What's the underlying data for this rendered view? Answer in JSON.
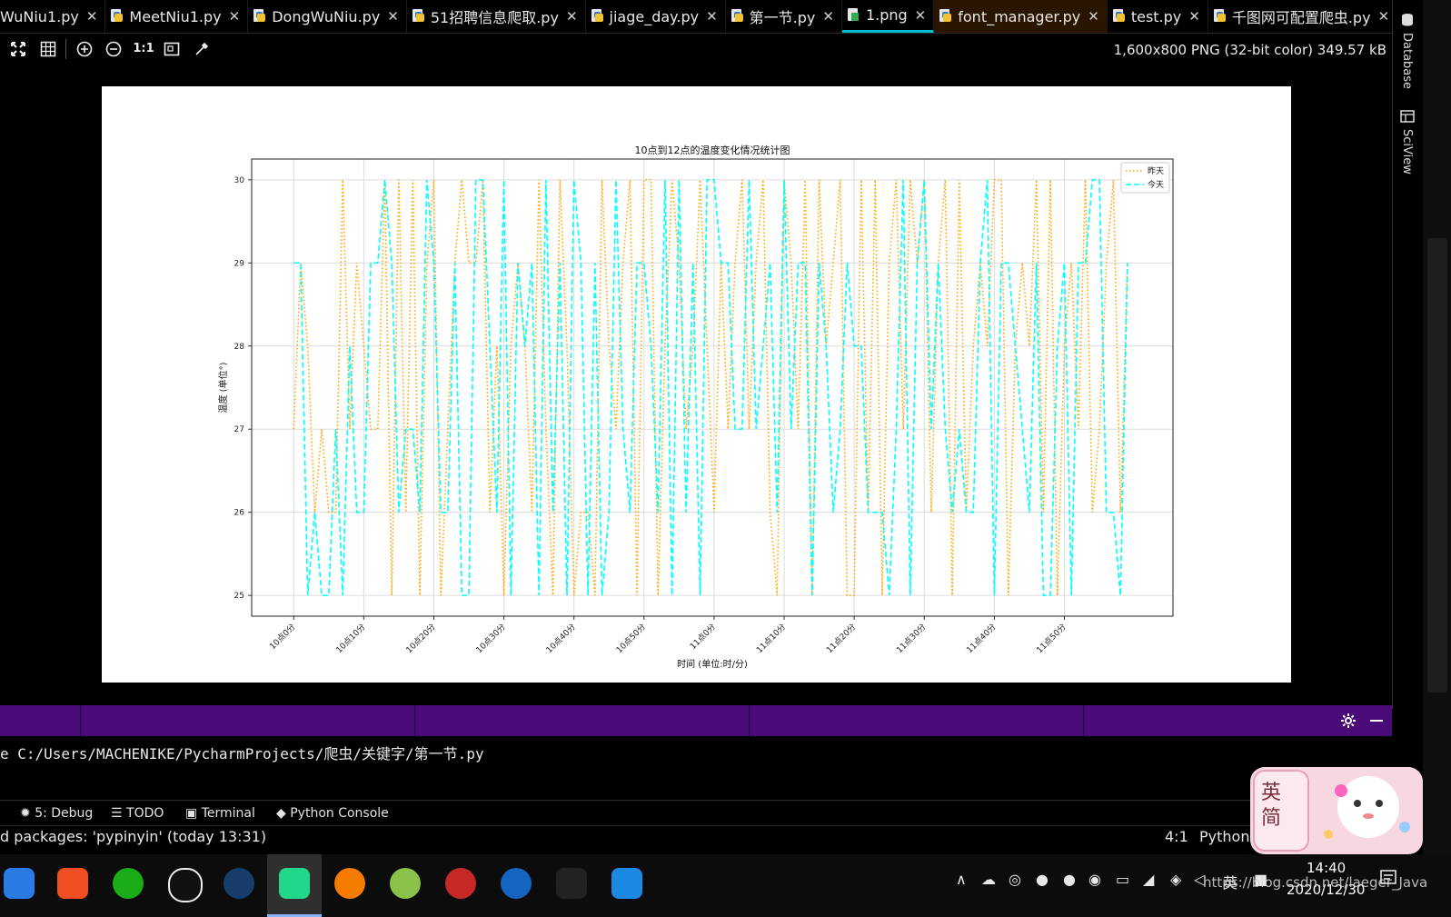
{
  "tabs": [
    {
      "label": "WuNiu1.py",
      "icon": "python-file-icon"
    },
    {
      "label": "MeetNiu1.py",
      "icon": "python-file-icon"
    },
    {
      "label": "DongWuNiu.py",
      "icon": "python-file-icon"
    },
    {
      "label": "51招聘信息爬取.py",
      "icon": "python-file-icon"
    },
    {
      "label": "jiage_day.py",
      "icon": "python-file-icon"
    },
    {
      "label": "第一节.py",
      "icon": "python-file-icon"
    },
    {
      "label": "1.png",
      "icon": "image-file-icon",
      "active": true
    },
    {
      "label": "font_manager.py",
      "icon": "python-file-icon",
      "highlighted": true
    },
    {
      "label": "test.py",
      "icon": "python-file-icon"
    },
    {
      "label": "千图网可配置爬虫.py",
      "icon": "python-file-icon"
    }
  ],
  "toolbar": {
    "zoom_actual_label": "1:1",
    "image_info": "1,600x800 PNG (32-bit color) 349.57 kB"
  },
  "right_strip": {
    "database": "Database",
    "sciview": "SciView"
  },
  "console": {
    "line": "e C:/Users/MACHENIKE/PycharmProjects/爬虫/关键字/第一节.py"
  },
  "tool_windows": {
    "debug": "5: Debug",
    "todo": "TODO",
    "terminal": "Terminal",
    "python_console": "Python Console"
  },
  "status": {
    "message": "d packages: 'pypinyin' (today 13:31)",
    "position": "4:1",
    "language": "Python"
  },
  "taskbar": {
    "time": "14:40",
    "date": "2020/12/30",
    "ime": "英",
    "watermark": "https://blog.csdn.net/laeger_Java"
  },
  "ime_sticker": {
    "line1": "英",
    "line2": "简"
  },
  "colors": {
    "accent": "#00bcd4",
    "purple": "#4a0a78",
    "yesterday": "#ffa500",
    "today": "#00ffff"
  },
  "chart_data": {
    "type": "line",
    "title": "10点到12点的温度变化情况统计图",
    "xlabel": "时间 (单位:时/分)",
    "ylabel": "温度 (单位°)",
    "ylim": [
      24.75,
      30.25
    ],
    "yticks": [
      25,
      26,
      27,
      28,
      29,
      30
    ],
    "xticks": [
      "10点0分",
      "10点10分",
      "10点20分",
      "10点30分",
      "10点40分",
      "10点50分",
      "11点0分",
      "11点10分",
      "11点20分",
      "11点30分",
      "11点40分",
      "11点50分"
    ],
    "legend": "top-right",
    "grid": true,
    "x": [
      0,
      1,
      2,
      3,
      4,
      5,
      6,
      7,
      8,
      9,
      10,
      11,
      12,
      13,
      14,
      15,
      16,
      17,
      18,
      19,
      20,
      21,
      22,
      23,
      24,
      25,
      26,
      27,
      28,
      29,
      30,
      31,
      32,
      33,
      34,
      35,
      36,
      37,
      38,
      39,
      40,
      41,
      42,
      43,
      44,
      45,
      46,
      47,
      48,
      49,
      50,
      51,
      52,
      53,
      54,
      55,
      56,
      57,
      58,
      59,
      60,
      61,
      62,
      63,
      64,
      65,
      66,
      67,
      68,
      69,
      70,
      71,
      72,
      73,
      74,
      75,
      76,
      77,
      78,
      79,
      80,
      81,
      82,
      83,
      84,
      85,
      86,
      87,
      88,
      89,
      90,
      91,
      92,
      93,
      94,
      95,
      96,
      97,
      98,
      99,
      100,
      101,
      102,
      103,
      104,
      105,
      106,
      107,
      108,
      109,
      110,
      111,
      112,
      113,
      114,
      115,
      116,
      117,
      118,
      119
    ],
    "series": [
      {
        "name": "昨天",
        "style": "dotted",
        "color": "#ffa500",
        "values": [
          27,
          29,
          28,
          26,
          27,
          26,
          26,
          30,
          27,
          29,
          28,
          27,
          27,
          30,
          25,
          30,
          26,
          30,
          25,
          29,
          30,
          25,
          27,
          29,
          30,
          29,
          29,
          30,
          26,
          28,
          25,
          28,
          29,
          28,
          26,
          30,
          27,
          25,
          30,
          28,
          25,
          26,
          26,
          25,
          30,
          28,
          27,
          29,
          30,
          25,
          30,
          30,
          25,
          28,
          30,
          29,
          27,
          28,
          30,
          28,
          26,
          29,
          27,
          29,
          30,
          27,
          29,
          30,
          26,
          25,
          30,
          29,
          27,
          30,
          25,
          30,
          28,
          29,
          30,
          25,
          25,
          30,
          26,
          30,
          25,
          29,
          30,
          27,
          30,
          29,
          30,
          26,
          29,
          30,
          25,
          30,
          26,
          28,
          29,
          28,
          30,
          30,
          25,
          28,
          29,
          28,
          30,
          26,
          30,
          25,
          28,
          29,
          27,
          30,
          26,
          27,
          29,
          30,
          26,
          29
        ]
      },
      {
        "name": "今天",
        "style": "dashed",
        "color": "#00ffff",
        "values": [
          29,
          29,
          25,
          26,
          25,
          25,
          27,
          25,
          28,
          26,
          26,
          29,
          29,
          30,
          29,
          26,
          27,
          27,
          26,
          30,
          29,
          26,
          26,
          29,
          25,
          25,
          30,
          30,
          28,
          26,
          30,
          25,
          29,
          28,
          29,
          25,
          30,
          26,
          29,
          25,
          30,
          29,
          25,
          29,
          25,
          26,
          30,
          27,
          26,
          29,
          29,
          28,
          26,
          30,
          25,
          30,
          26,
          29,
          25,
          30,
          30,
          29,
          29,
          27,
          27,
          30,
          27,
          28,
          29,
          26,
          30,
          27,
          29,
          29,
          25,
          29,
          28,
          26,
          27,
          29,
          28,
          28,
          26,
          26,
          26,
          25,
          27,
          30,
          25,
          29,
          30,
          27,
          29,
          27,
          26,
          27,
          26,
          26,
          29,
          30,
          25,
          29,
          29,
          28,
          27,
          26,
          29,
          25,
          25,
          28,
          29,
          25,
          29,
          29,
          30,
          30,
          26,
          26,
          25,
          29
        ]
      }
    ]
  }
}
